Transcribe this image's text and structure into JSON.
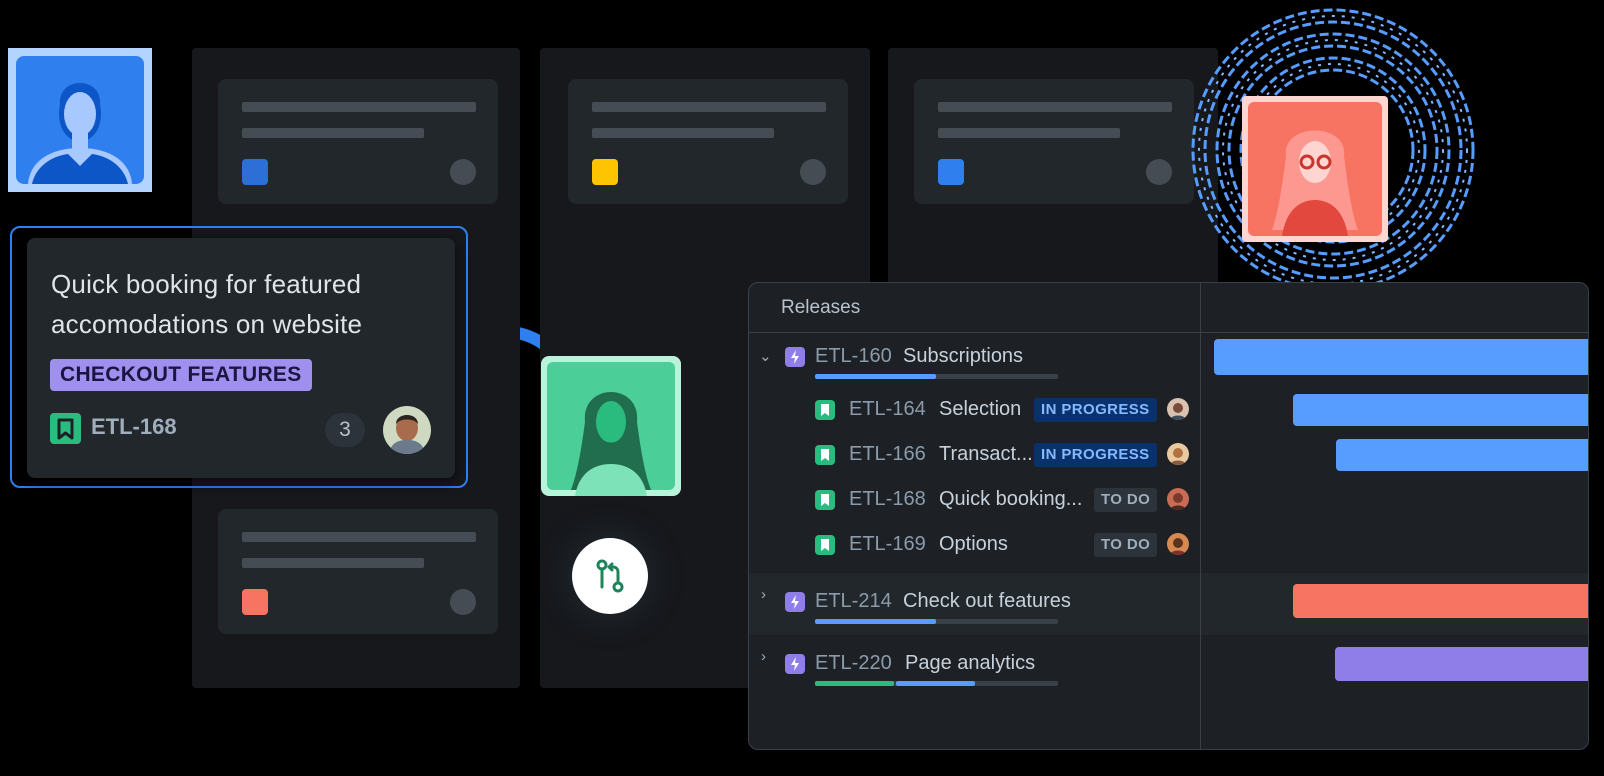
{
  "colors": {
    "board_blue_square": "#2c6fd6",
    "board_yellow_square": "#ffc400",
    "board_lightblue_square": "#2f7fef",
    "board_orange_square": "#f87462",
    "accent_blue": "#2f7fef",
    "tag_purple": "#9f8fef",
    "story_green": "#2abb7f",
    "epic_purple": "#8f7ee7",
    "gantt_blue": "#579dff",
    "gantt_red": "#f87462",
    "gantt_purple": "#8f7ee7"
  },
  "issue_card": {
    "title": "Quick booking for featured accomodations on website",
    "tag": "CHECKOUT FEATURES",
    "key": "ETL-168",
    "count": "3",
    "icon": "bookmark-icon"
  },
  "releases": {
    "title": "Releases",
    "rows": [
      {
        "kind": "epic",
        "expanded": true,
        "key": "ETL-160",
        "name": "Subscriptions",
        "progress": [
          0.5
        ],
        "gantt_color": "#579dff"
      },
      {
        "kind": "story",
        "key": "ETL-164",
        "name": "Selection",
        "status": "IN PROGRESS",
        "gantt_color": "#579dff"
      },
      {
        "kind": "story",
        "key": "ETL-166",
        "name": "Transact...",
        "status": "IN PROGRESS",
        "gantt_color": "#579dff"
      },
      {
        "kind": "story",
        "key": "ETL-168",
        "name": "Quick booking...",
        "status": "TO DO"
      },
      {
        "kind": "story",
        "key": "ETL-169",
        "name": "Options",
        "status": "TO DO"
      },
      {
        "kind": "epic",
        "expanded": false,
        "key": "ETL-214",
        "name": "Check out features",
        "progress": [
          0.5
        ],
        "gantt_color": "#f87462"
      },
      {
        "kind": "epic",
        "expanded": false,
        "key": "ETL-220",
        "name": "Page analytics",
        "progress": [
          0.33,
          0.33
        ],
        "gantt_color": "#8f7ee7"
      }
    ]
  },
  "icons": {
    "pull_request": "pull-request-icon",
    "epic": "lightning-icon",
    "story": "bookmark-icon"
  }
}
